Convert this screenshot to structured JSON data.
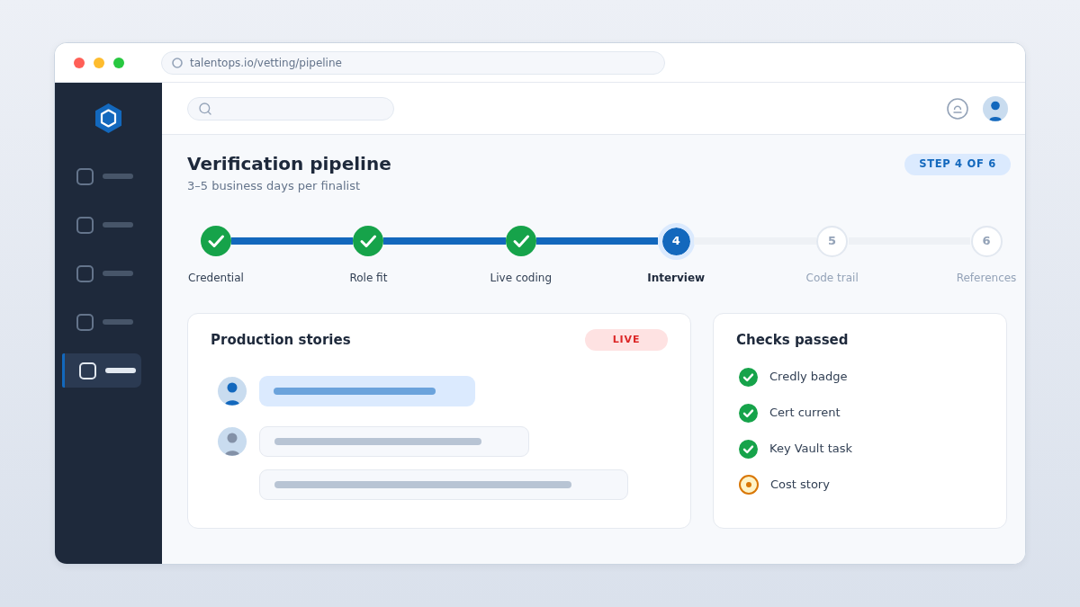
{
  "browser": {
    "url": "talentops.io/vetting/pipeline"
  },
  "sidebar": {
    "items": [
      {
        "selected": false
      },
      {
        "selected": false
      },
      {
        "selected": false
      },
      {
        "selected": false
      },
      {
        "selected": true
      }
    ]
  },
  "page": {
    "title": "Verification pipeline",
    "subtitle": "3–5 business days per finalist",
    "step_badge": "STEP 4 OF 6"
  },
  "steps": [
    {
      "label": "Credential",
      "done": true,
      "selected": false
    },
    {
      "label": "Role fit",
      "done": true,
      "selected": false
    },
    {
      "label": "Live coding",
      "done": true,
      "selected": false
    },
    {
      "label": "Interview",
      "done": false,
      "selected": true,
      "number": "4"
    },
    {
      "label": "Code trail",
      "done": false,
      "selected": false,
      "number": "5"
    },
    {
      "label": "References",
      "done": false,
      "selected": false,
      "number": "6"
    }
  ],
  "stories_card": {
    "title": "Production stories",
    "badge": "LIVE",
    "messages": [
      {
        "highlighted": true,
        "avatar": true
      },
      {
        "highlighted": false,
        "avatar": true
      },
      {
        "highlighted": false,
        "avatar": false
      }
    ]
  },
  "checks_card": {
    "title": "Checks passed",
    "items": [
      {
        "label": "Credly badge",
        "passed": true
      },
      {
        "label": "Cert current",
        "passed": true
      },
      {
        "label": "Key Vault task",
        "passed": true
      },
      {
        "label": "Cost story",
        "passed": false
      }
    ]
  }
}
